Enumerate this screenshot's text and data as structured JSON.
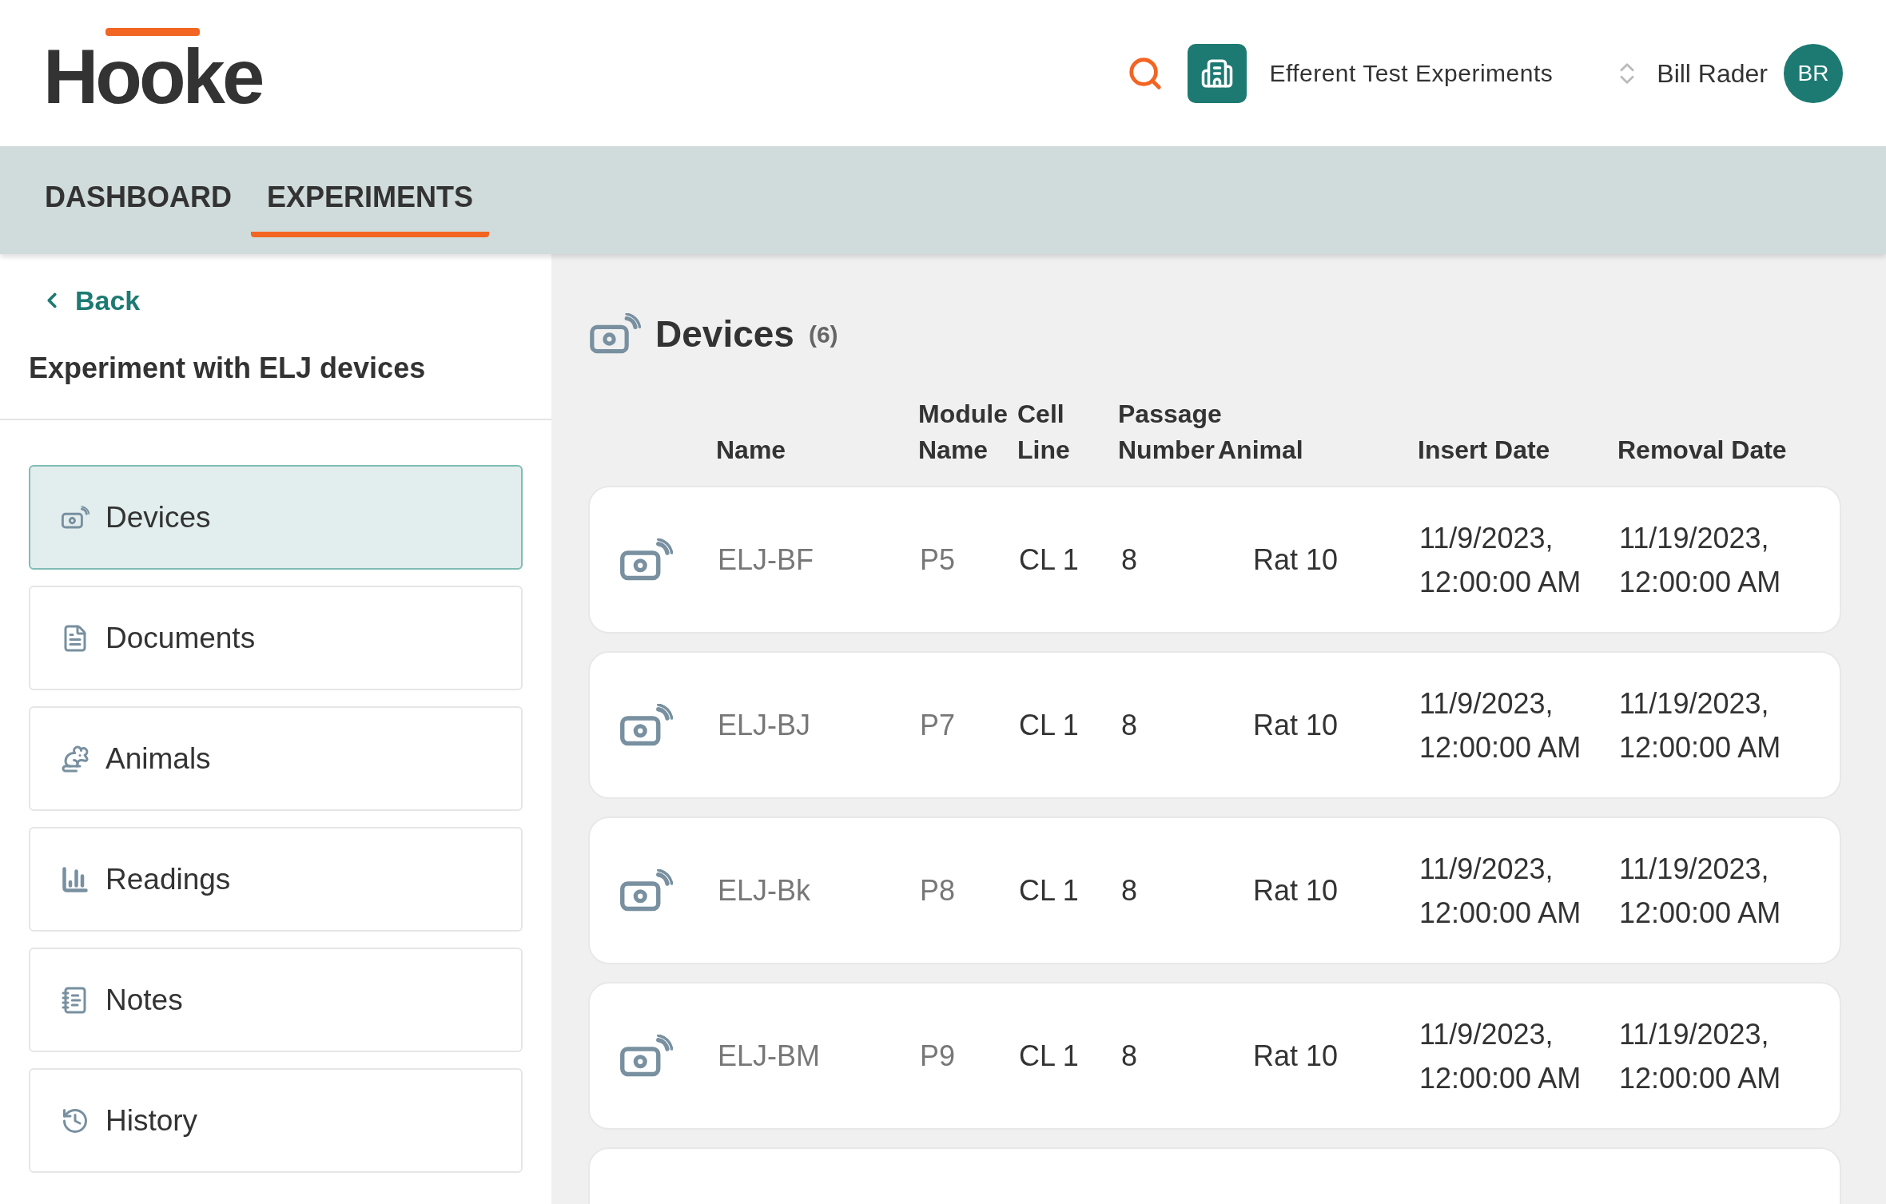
{
  "brand": {
    "logo": "Hooke"
  },
  "header": {
    "organization": "Efferent Test Experiments",
    "user_name": "Bill Rader",
    "user_initials": "BR"
  },
  "nav_tabs": [
    {
      "label": "DASHBOARD",
      "selected": false
    },
    {
      "label": "EXPERIMENTS",
      "selected": true
    }
  ],
  "sidebar": {
    "back": "Back",
    "title": "Experiment with ELJ devices",
    "items": [
      {
        "label": "Devices",
        "kind": "device",
        "selected": true
      },
      {
        "label": "Documents",
        "kind": "document",
        "selected": false
      },
      {
        "label": "Animals",
        "kind": "animal",
        "selected": false
      },
      {
        "label": "Readings",
        "kind": "chart",
        "selected": false
      },
      {
        "label": "Notes",
        "kind": "notes",
        "selected": false
      },
      {
        "label": "History",
        "kind": "history",
        "selected": false
      }
    ]
  },
  "devices": {
    "title": "Devices",
    "count": "(6)",
    "columns": [
      [
        "Name"
      ],
      [
        "Module",
        "Name"
      ],
      [
        "Cell",
        "Line"
      ],
      [
        "Passage",
        "Number"
      ],
      [
        "Animal"
      ],
      [
        "Insert Date"
      ],
      [
        "Removal Date"
      ]
    ],
    "rows": [
      {
        "name": "ELJ-BF",
        "module": "P5",
        "cell_line": "CL 1",
        "passage": "8",
        "animal": "Rat 10",
        "insert": [
          "11/9/2023,",
          "12:00:00 AM"
        ],
        "removal": [
          "11/19/2023,",
          "12:00:00 AM"
        ]
      },
      {
        "name": "ELJ-BJ",
        "module": "P7",
        "cell_line": "CL 1",
        "passage": "8",
        "animal": "Rat 10",
        "insert": [
          "11/9/2023,",
          "12:00:00 AM"
        ],
        "removal": [
          "11/19/2023,",
          "12:00:00 AM"
        ]
      },
      {
        "name": "ELJ-Bk",
        "module": "P8",
        "cell_line": "CL 1",
        "passage": "8",
        "animal": "Rat 10",
        "insert": [
          "11/9/2023,",
          "12:00:00 AM"
        ],
        "removal": [
          "11/19/2023,",
          "12:00:00 AM"
        ]
      },
      {
        "name": "ELJ-BM",
        "module": "P9",
        "cell_line": "CL 1",
        "passage": "8",
        "animal": "Rat 10",
        "insert": [
          "11/9/2023,",
          "12:00:00 AM"
        ],
        "removal": [
          "11/19/2023,",
          "12:00:00 AM"
        ]
      }
    ]
  }
}
